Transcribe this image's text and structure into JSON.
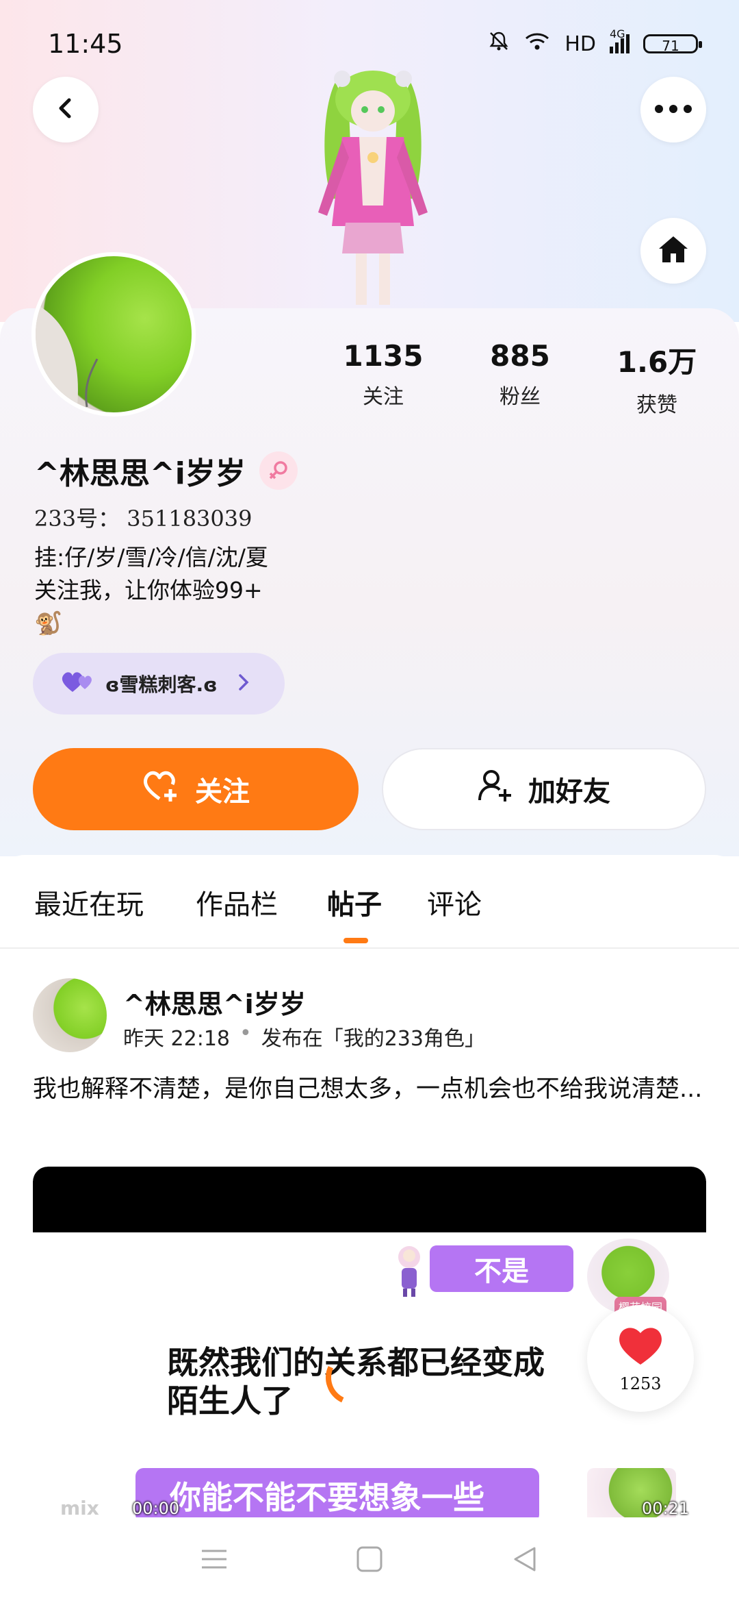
{
  "status_bar": {
    "time": "11:45",
    "network": "HD",
    "signal_label": "4G",
    "battery": "71"
  },
  "profile": {
    "name": "^林思思^i岁岁",
    "uid": "233号： 351183039",
    "bio_lines": [
      "挂:仔/岁/雪/冷/信/沈/夏",
      "关注我，让你体验99+",
      "🐒"
    ],
    "badge_text": "ɞ雪糕刺客.ɞ",
    "stats": [
      {
        "value": "1135",
        "label": "关注"
      },
      {
        "value": "885",
        "label": "粉丝"
      },
      {
        "value": "1.6万",
        "label": "获赞"
      }
    ]
  },
  "actions": {
    "follow_label": "关注",
    "add_friend_label": "加好友"
  },
  "tabs": [
    {
      "label": "最近在玩"
    },
    {
      "label": "作品栏"
    },
    {
      "label": "帖子"
    },
    {
      "label": "评论"
    }
  ],
  "post": {
    "author": "^林思思^i岁岁",
    "time": "昨天 22:18",
    "dot": "•",
    "published_in": "发布在「我的233角色」",
    "text": "我也解释不清楚，是你自己想太多，一点机会也不给我说清楚...",
    "video": {
      "bubble_top": "不是",
      "subtitle_line1": "既然我们的关系都已经变成",
      "subtitle_line2": "陌生人了",
      "bubble_bottom": "你能不能不要想象一些",
      "time_left": "00:00",
      "time_right": "00:21",
      "watermark": "mix",
      "scene_label": "樱花校园"
    }
  },
  "like_fab": {
    "count": "1253"
  },
  "colors": {
    "accent": "#ff7a14",
    "badge_bg": "#e6e0f7",
    "bubble": "#b575f3",
    "like_red": "#f0303a"
  }
}
